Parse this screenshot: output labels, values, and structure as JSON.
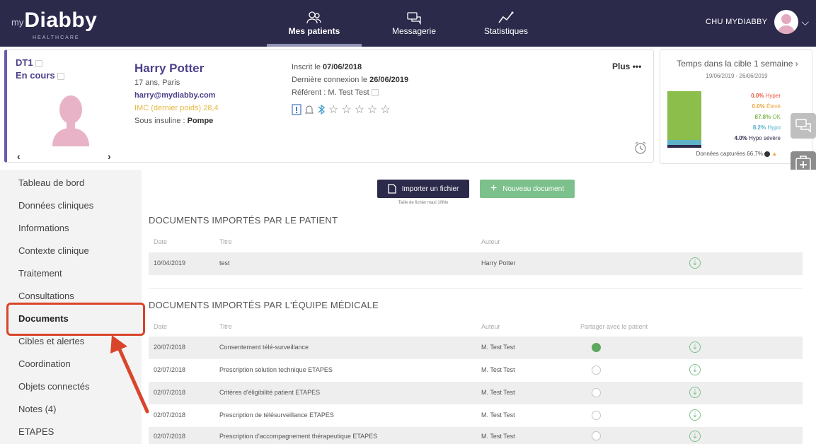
{
  "header": {
    "logo_prefix": "my",
    "logo_name": "Diabby",
    "logo_sub": "HEALTHCARE",
    "nav": [
      {
        "label": "Mes patients",
        "icon": "patients-icon"
      },
      {
        "label": "Messagerie",
        "icon": "chat-icon"
      },
      {
        "label": "Statistiques",
        "icon": "stats-icon"
      }
    ],
    "org_name": "CHU MYDIABBY"
  },
  "patient": {
    "type": "DT1",
    "status": "En cours",
    "name": "Harry Potter",
    "age_city": "17 ans, Paris",
    "email": "harry@mydiabby.com",
    "imc": "IMC (dernier poids) 28,4",
    "insuline_label": "Sous insuline : ",
    "insuline_value": "Pompe",
    "inscrit_label": "Inscrit le ",
    "inscrit_date": "07/06/2018",
    "last_login_label": "Dernière connexion le ",
    "last_login_date": "26/06/2019",
    "referent": "Référent : M. Test Test",
    "more_label": "Plus",
    "more_dots": "•••",
    "prev_arrow": "‹",
    "next_arrow": "›"
  },
  "cible": {
    "title": "Temps dans la cible 1 semaine",
    "arrow": "›",
    "dates": "19/06/2019 - 26/06/2019",
    "legend": [
      {
        "value": "0.0%",
        "label": "Hyper",
        "color": "#e8553e"
      },
      {
        "value": "0.0%",
        "label": "Élevé",
        "color": "#f0a33b"
      },
      {
        "value": "87.8%",
        "label": "OK",
        "color": "#7ab648"
      },
      {
        "value": "8.2%",
        "label": "Hypo",
        "color": "#4fb0cc"
      },
      {
        "value": "4.0%",
        "label": "Hypo sévère",
        "color": "#2c2a4b"
      }
    ],
    "captured": "Données capturées   66,7%"
  },
  "sidebar": {
    "items": [
      "Tableau de bord",
      "Données cliniques",
      "Informations",
      "Contexte clinique",
      "Traitement",
      "Consultations",
      "Documents",
      "Cibles et alertes",
      "Coordination",
      "Objets connectés",
      "Notes (4)",
      "ETAPES"
    ]
  },
  "actions": {
    "import_label": "Importer un fichier",
    "new_label": "Nouveau document",
    "max_size": "Taille de fichier maxi 10Mo"
  },
  "patient_docs": {
    "title": "DOCUMENTS IMPORTÉS PAR LE PATIENT",
    "headers": {
      "date": "Date",
      "title": "Titre",
      "author": "Auteur"
    },
    "rows": [
      {
        "date": "10/04/2019",
        "title": "test",
        "author": "Harry Potter"
      }
    ]
  },
  "medical_docs": {
    "title": "DOCUMENTS IMPORTÉS PAR L'ÉQUIPE MÉDICALE",
    "headers": {
      "date": "Date",
      "title": "Titre",
      "author": "Auteur",
      "share": "Partager avec le patient"
    },
    "rows": [
      {
        "date": "20/07/2018",
        "title": "Consentement télé-surveillance",
        "author": "M. Test Test",
        "shared": true
      },
      {
        "date": "02/07/2018",
        "title": "Prescription solution technique ETAPES",
        "author": "M. Test Test",
        "shared": false
      },
      {
        "date": "02/07/2018",
        "title": "Critères d'éligibilité patient ETAPES",
        "author": "M. Test Test",
        "shared": false
      },
      {
        "date": "02/07/2018",
        "title": "Prescription de télésurveillance ETAPES",
        "author": "M. Test Test",
        "shared": false
      },
      {
        "date": "02/07/2018",
        "title": "Prescription d'accompagnement thérapeutique ETAPES",
        "author": "M. Test Test",
        "shared": false
      }
    ]
  },
  "colors": {
    "topbar": "#2c2a4b",
    "accent": "#4d3f8a",
    "green": "#7cc08b",
    "highlight": "#d9452b"
  }
}
